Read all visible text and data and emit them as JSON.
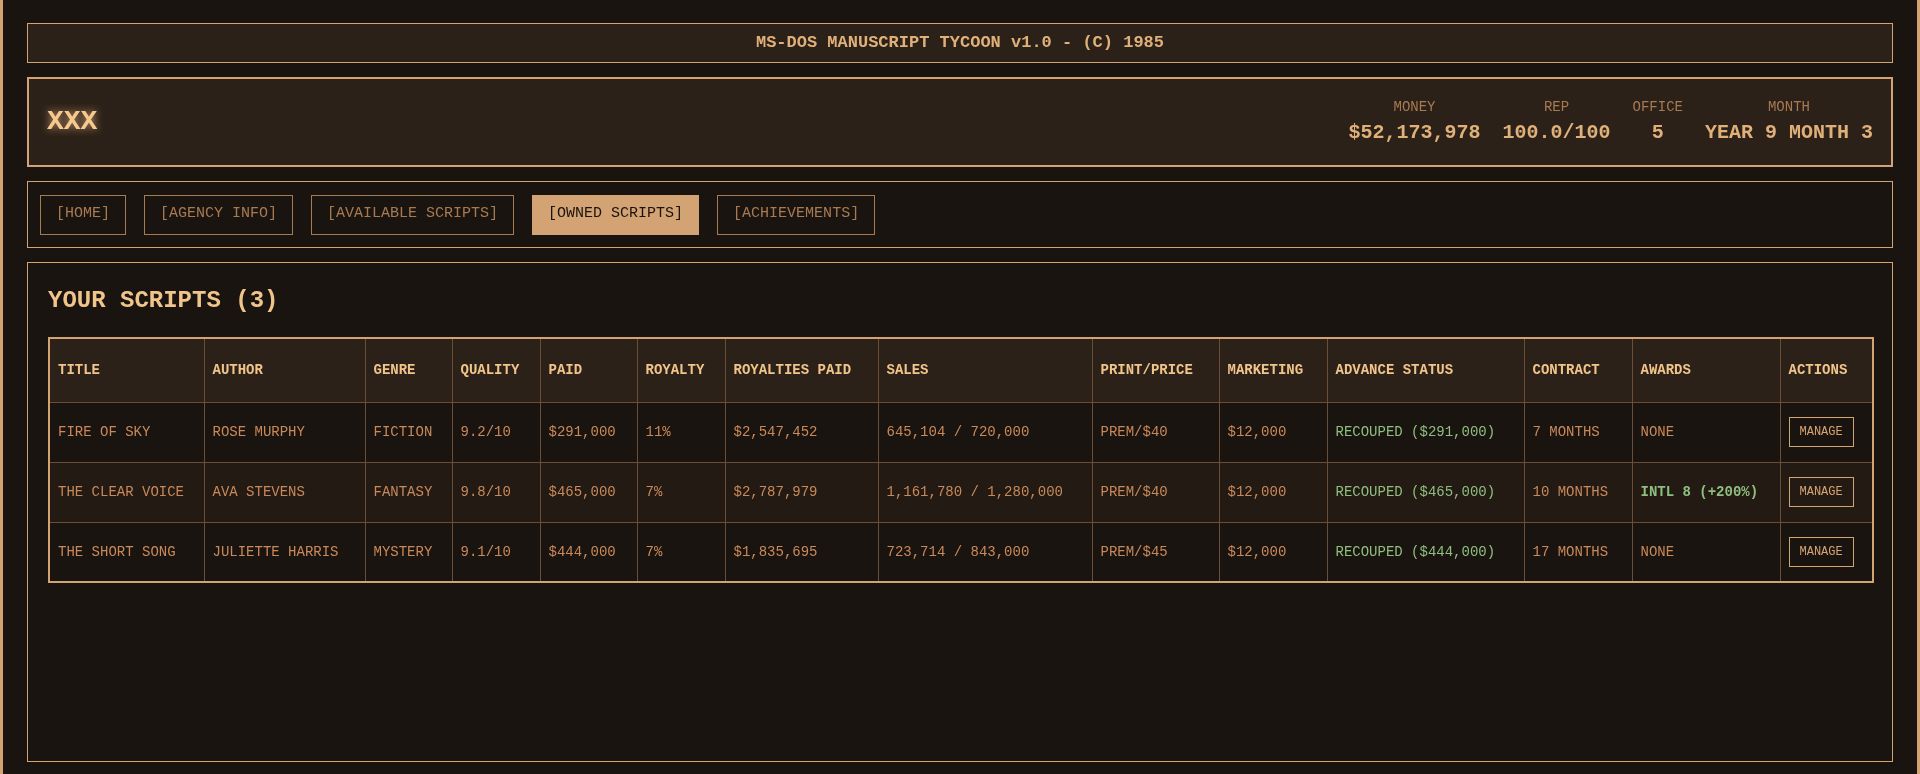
{
  "title_bar": "MS-DOS MANUSCRIPT TYCOON v1.0 - (C) 1985",
  "header": {
    "agency": "XXX",
    "stats": [
      {
        "label": "MONEY",
        "value": "$52,173,978"
      },
      {
        "label": "REP",
        "value": "100.0/100"
      },
      {
        "label": "OFFICE",
        "value": "5"
      },
      {
        "label": "MONTH",
        "value": "YEAR 9 MONTH 3"
      }
    ]
  },
  "tabs": [
    {
      "label": "[HOME]",
      "selected": false
    },
    {
      "label": "[AGENCY INFO]",
      "selected": false
    },
    {
      "label": "[AVAILABLE SCRIPTS]",
      "selected": false
    },
    {
      "label": "[OWNED SCRIPTS]",
      "selected": true
    },
    {
      "label": "[ACHIEVEMENTS]",
      "selected": false
    }
  ],
  "section_title": "YOUR SCRIPTS (3)",
  "table": {
    "columns": [
      "TITLE",
      "AUTHOR",
      "GENRE",
      "QUALITY",
      "PAID",
      "ROYALTY",
      "ROYALTIES PAID",
      "SALES",
      "PRINT/PRICE",
      "MARKETING",
      "ADVANCE STATUS",
      "CONTRACT",
      "AWARDS",
      "ACTIONS"
    ],
    "rows": [
      {
        "title": "FIRE OF SKY",
        "author": "ROSE MURPHY",
        "genre": "FICTION",
        "quality": "9.2/10",
        "paid": "$291,000",
        "royalty": "11%",
        "royalties_paid": "$2,547,452",
        "sales": "645,104 / 720,000",
        "print_price": "PREM/$40",
        "marketing": "$12,000",
        "advance_status": "RECOUPED ($291,000)",
        "contract": "7 MONTHS",
        "awards": {
          "text": "NONE",
          "won": false
        },
        "action": "MANAGE"
      },
      {
        "title": "THE CLEAR VOICE",
        "author": "AVA STEVENS",
        "genre": "FANTASY",
        "quality": "9.8/10",
        "paid": "$465,000",
        "royalty": "7%",
        "royalties_paid": "$2,787,979",
        "sales": "1,161,780 / 1,280,000",
        "print_price": "PREM/$40",
        "marketing": "$12,000",
        "advance_status": "RECOUPED ($465,000)",
        "contract": "10 MONTHS",
        "awards": {
          "text": "INTL 8 (+200%)",
          "won": true
        },
        "action": "MANAGE"
      },
      {
        "title": "THE SHORT SONG",
        "author": "JULIETTE HARRIS",
        "genre": "MYSTERY",
        "quality": "9.1/10",
        "paid": "$444,000",
        "royalty": "7%",
        "royalties_paid": "$1,835,695",
        "sales": "723,714 / 843,000",
        "print_price": "PREM/$45",
        "marketing": "$12,000",
        "advance_status": "RECOUPED ($444,000)",
        "contract": "17 MONTHS",
        "awards": {
          "text": "NONE",
          "won": false
        },
        "action": "MANAGE"
      }
    ]
  }
}
